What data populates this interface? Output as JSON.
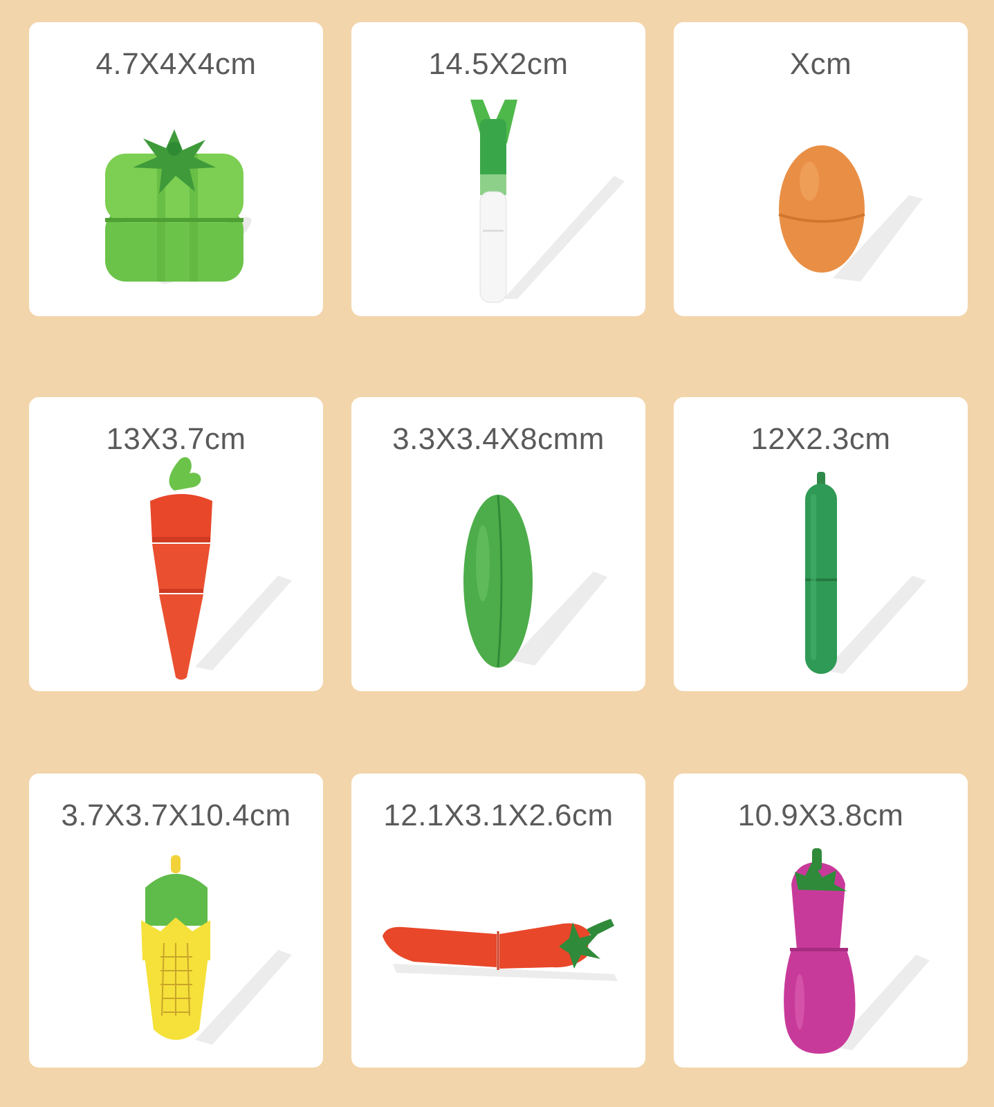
{
  "items": [
    {
      "label": "4.7X4X4cm",
      "icon": "green-pepper-icon"
    },
    {
      "label": "14.5X2cm",
      "icon": "green-onion-icon"
    },
    {
      "label": "Xcm",
      "icon": "egg-icon"
    },
    {
      "label": "13X3.7cm",
      "icon": "carrot-icon"
    },
    {
      "label": "3.3X3.4X8cmm",
      "icon": "pea-pod-icon"
    },
    {
      "label": "12X2.3cm",
      "icon": "cucumber-icon"
    },
    {
      "label": "3.7X3.7X10.4cm",
      "icon": "corn-icon"
    },
    {
      "label": "12.1X3.1X2.6cm",
      "icon": "chili-pepper-icon"
    },
    {
      "label": "10.9X3.8cm",
      "icon": "eggplant-icon"
    }
  ],
  "colors": {
    "background": "#f3d5ab",
    "card": "#ffffff",
    "label_text": "#5a5a5a"
  }
}
